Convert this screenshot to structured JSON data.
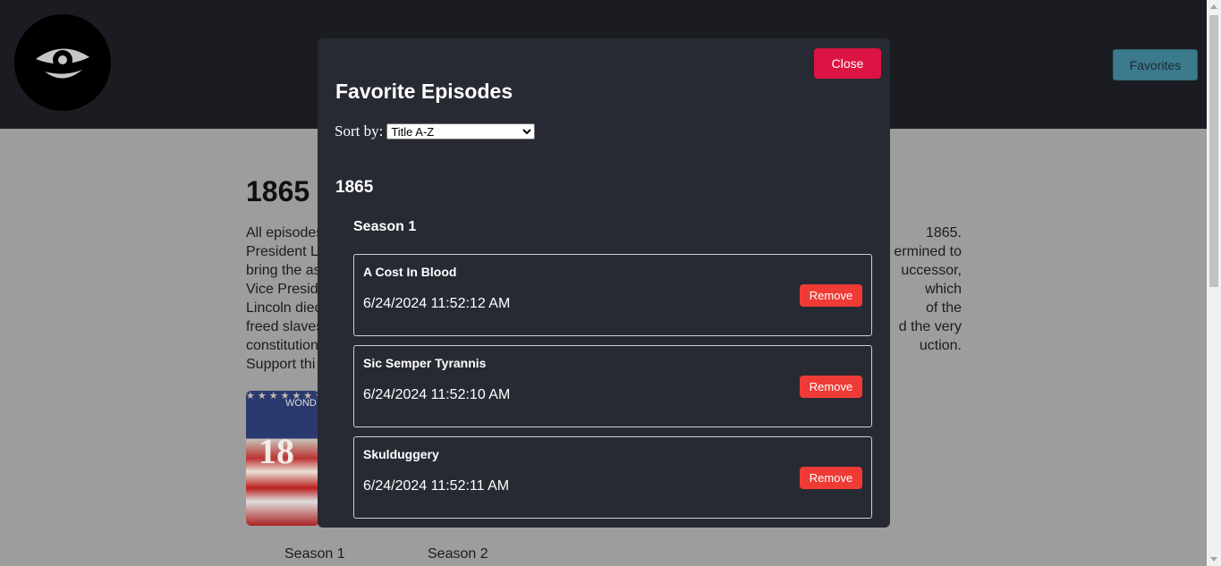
{
  "header": {
    "favorites_label": "Favorites"
  },
  "show": {
    "title": "1865",
    "description_lines": [
      {
        "left": "All episodes",
        "right": "1865."
      },
      {
        "left": "President Li",
        "right": "ermined to"
      },
      {
        "left": "bring the as",
        "right": "uccessor,"
      },
      {
        "left": "Vice Preside",
        "right": "which"
      },
      {
        "left": "Lincoln diec",
        "right": "of the"
      },
      {
        "left": "freed slaves",
        "right": "d the very"
      },
      {
        "left": "constitution",
        "right": "uction."
      },
      {
        "left": "Support thi",
        "right": ""
      }
    ],
    "cover": {
      "stars": "★★★★★★★★★★★★★★★★★★★★★★★★★★★★★★★★★★★★★★",
      "brand": "WOND",
      "number": "18"
    },
    "season_labels": [
      "Season 1",
      "Season 2"
    ]
  },
  "modal": {
    "close_label": "Close",
    "title": "Favorite Episodes",
    "sort_label": "Sort by:",
    "sort_selected": "Title A-Z",
    "group_title": "1865",
    "season_title": "Season 1",
    "episodes": [
      {
        "title": "A Cost In Blood",
        "date": "6/24/2024 11:52:12 AM",
        "remove_label": "Remove"
      },
      {
        "title": "Sic Semper Tyrannis",
        "date": "6/24/2024 11:52:10 AM",
        "remove_label": "Remove"
      },
      {
        "title": "Skulduggery",
        "date": "6/24/2024 11:52:11 AM",
        "remove_label": "Remove"
      }
    ]
  },
  "colors": {
    "header_bg": "#1b1c22",
    "modal_bg": "#272a33",
    "close_red": "#dc1443",
    "remove_red": "#ef3b36",
    "favorites_teal": "#3a7a8c"
  },
  "icons": {
    "logo": "eye-icon"
  }
}
